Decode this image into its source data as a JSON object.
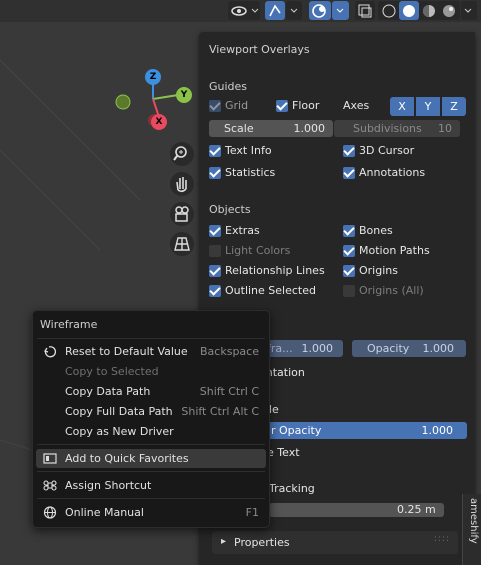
{
  "overlays": {
    "title": "Viewport Overlays",
    "guides": {
      "heading": "Guides",
      "grid": "Grid",
      "floor": "Floor",
      "axes_label": "Axes",
      "axes": [
        "X",
        "Y",
        "Z"
      ],
      "scale_label": "Scale",
      "scale_value": "1.000",
      "subdivisions_label": "Subdivisions",
      "subdivisions_value": "10",
      "text_info": "Text Info",
      "cursor_3d": "3D Cursor",
      "statistics": "Statistics",
      "annotations": "Annotations"
    },
    "objects": {
      "heading": "Objects",
      "extras": "Extras",
      "bones": "Bones",
      "light_colors": "Light Colors",
      "motion_paths": "Motion Paths",
      "relationship_lines": "Relationship Lines",
      "origins": "Origins",
      "outline_selected": "Outline Selected",
      "origins_all": "Origins (All)"
    },
    "partial": {
      "wireframe_field": "frа...",
      "wireframe_value": "1.000",
      "opacity_label": "Opacity",
      "opacity_value": "1.000",
      "orientation_text": "entation",
      "le_text": "le",
      "r_opacity_label": "r Opacity",
      "r_opacity_value": "1.000",
      "e_text": "e Text",
      "tracking_text": "Tracking",
      "measure_value": "0.25 m"
    },
    "properties_label": "Properties",
    "side_tab": "ameshify"
  },
  "context_menu": {
    "title": "Wireframe",
    "items": [
      {
        "label": "Reset to Default Value",
        "shortcut": "Backspace",
        "enabled": true
      },
      {
        "label": "Copy to Selected",
        "shortcut": "",
        "enabled": false
      },
      {
        "label": "Copy Data Path",
        "shortcut": "Shift Ctrl C",
        "enabled": true
      },
      {
        "label": "Copy Full Data Path",
        "shortcut": "Shift Ctrl Alt C",
        "enabled": true
      },
      {
        "label": "Copy as New Driver",
        "shortcut": "",
        "enabled": true
      },
      {
        "label": "Add to Quick Favorites",
        "shortcut": "",
        "enabled": true
      },
      {
        "label": "Assign Shortcut",
        "shortcut": "",
        "enabled": true
      },
      {
        "label": "Online Manual",
        "shortcut": "F1",
        "enabled": true
      }
    ]
  },
  "gizmo": {
    "x": "X",
    "y": "Y",
    "z": "Z"
  },
  "colors": {
    "accent": "#4772b3",
    "panel": "#262626",
    "menu": "#181818",
    "x_axis": "#e84a5f",
    "y_axis": "#8bc34a",
    "z_axis": "#3d8fe0"
  }
}
